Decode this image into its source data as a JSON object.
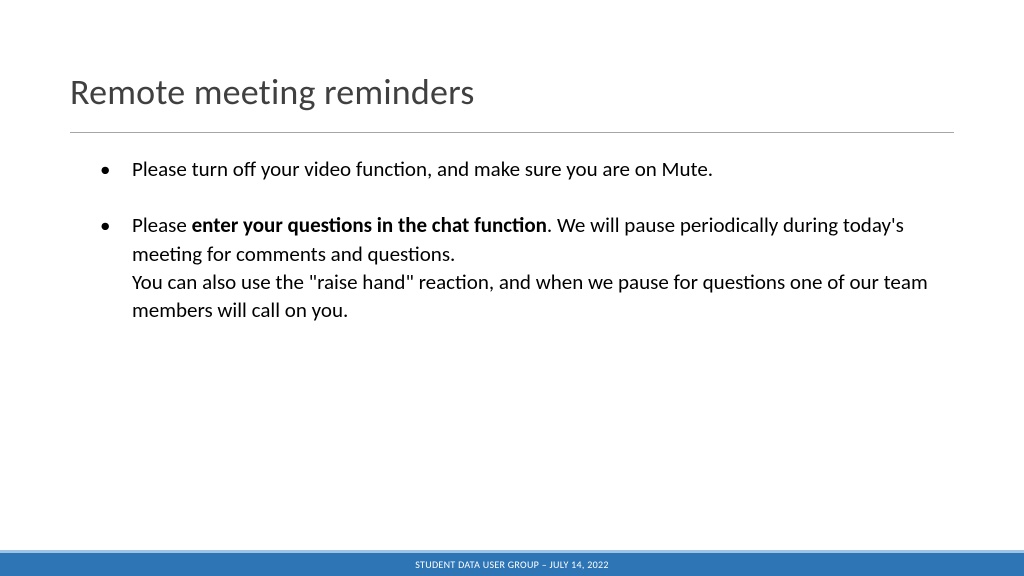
{
  "slide": {
    "title": "Remote meeting reminders",
    "bullets": [
      {
        "text_before": "Please turn off your video function, and make sure you are on Mute.",
        "text_bold": "",
        "text_after": ""
      },
      {
        "text_before": "Please ",
        "text_bold": "enter your questions in the chat function",
        "text_after": ".  We will pause periodically during today's meeting for comments and questions.\nYou can also use the \"raise hand\" reaction, and when we pause for questions one of our team members will call on you."
      }
    ],
    "footer": "STUDENT DATA USER GROUP – JULY 14, 2022"
  }
}
